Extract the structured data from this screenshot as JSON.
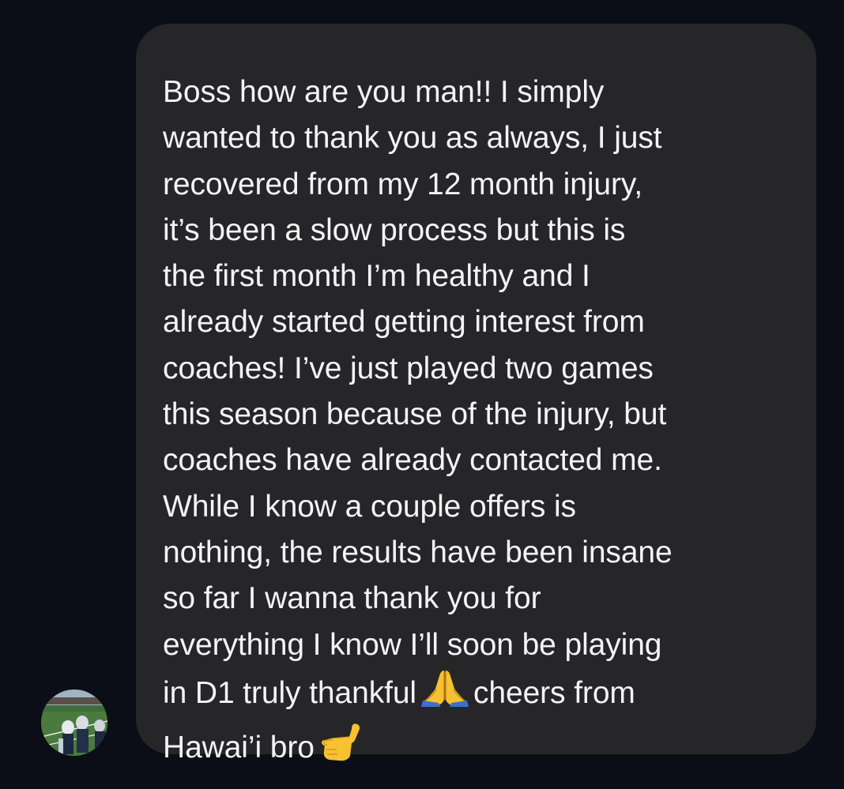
{
  "conversation": {
    "message_lines": [
      "Boss how are you man!! I simply",
      "wanted to thank you as always, I just",
      "recovered from my 12 month injury,",
      "it’s been a slow process but this is",
      "the first month I’m healthy and I",
      "already started getting interest from",
      "coaches! I’ve just played two games",
      "this season because of the injury, but",
      "coaches have already contacted me.",
      "While I know a couple offers is",
      "nothing, the results have been insane",
      "so far I wanna thank you for",
      "everything I know I’ll soon be playing"
    ],
    "line_14_before_emoji": "in D1 truly thankful",
    "line_14_after_emoji": "cheers from",
    "line_15_text": "Hawai’i bro",
    "emoji_1": "folded-hands-icon",
    "emoji_2": "call-me-hand-icon"
  },
  "colors": {
    "background": "#0b0e16",
    "bubble": "#262628",
    "text": "#f4f4f6"
  }
}
